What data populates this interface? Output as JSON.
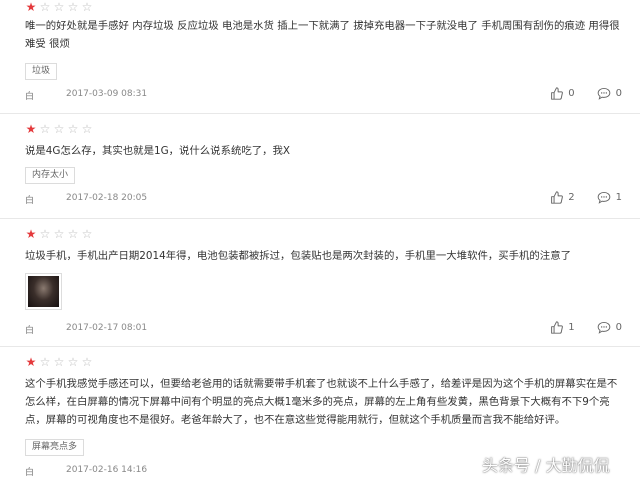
{
  "colors": {
    "star_filled": "#e4393c",
    "star_empty": "#bbbbbb",
    "divider": "#e8e8e8"
  },
  "reviews": [
    {
      "rating": 1,
      "max_rating": 5,
      "text": "唯一的好处就是手感好 内存垃圾 反应垃圾 电池是水货 插上一下就满了 拔掉充电器一下子就没电了 手机周围有刮伤的痕迹 用得很难受 很烦",
      "tag": "垃圾",
      "color": "白",
      "date": "2017-03-09 08:31",
      "likes": "0",
      "comments": "0"
    },
    {
      "rating": 1,
      "max_rating": 5,
      "text": "说是4G怎么存，其实也就是1G，说什么说系统吃了，我X",
      "tag": "内存太小",
      "color": "白",
      "date": "2017-02-18 20:05",
      "likes": "2",
      "comments": "1"
    },
    {
      "rating": 1,
      "max_rating": 5,
      "text": "垃圾手机，手机出产日期2014年得，电池包装都被拆过，包装贴也是两次封装的，手机里一大堆软件，买手机的注意了",
      "color": "白",
      "date": "2017-02-17 08:01",
      "likes": "1",
      "comments": "0"
    },
    {
      "rating": 1,
      "max_rating": 5,
      "text": "这个手机我感觉手感还可以，但要给老爸用的话就需要带手机套了也就谈不上什么手感了，给差评是因为这个手机的屏幕实在是不怎么样，在白屏幕的情况下屏幕中间有个明显的亮点大概1毫米多的亮点，屏幕的左上角有些发黄，黑色背景下大概有不下9个亮点，屏幕的可视角度也不是很好。老爸年龄大了，也不在意这些觉得能用就行，但就这个手机质量而言我不能给好评。",
      "tag": "屏幕亮点多",
      "color": "白",
      "date": "2017-02-16 14:16"
    }
  ],
  "watermark": "头条号 / 大勤侃侃"
}
